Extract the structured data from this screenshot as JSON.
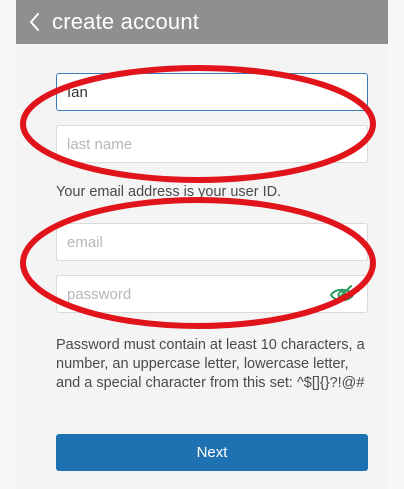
{
  "header": {
    "title": "create account",
    "back_icon": "chevron-left-icon"
  },
  "form": {
    "first_name": {
      "value": "Ian",
      "placeholder": ""
    },
    "last_name": {
      "value": "",
      "placeholder": "last name"
    },
    "email_note": "Your email address is your user ID.",
    "email": {
      "value": "",
      "placeholder": "email"
    },
    "password": {
      "value": "",
      "placeholder": "password",
      "toggle_icon": "eye-hidden-icon",
      "toggle_color": "#2a9a5d"
    },
    "password_rules": "Password must contain at least 10 characters, a number, an uppercase letter, lowercase letter, and a special character from this set: ^$[]{}?!@#",
    "next_label": "Next",
    "accent_color": "#1f72b1"
  },
  "annotations": {
    "highlight_color": "#e0141a"
  }
}
